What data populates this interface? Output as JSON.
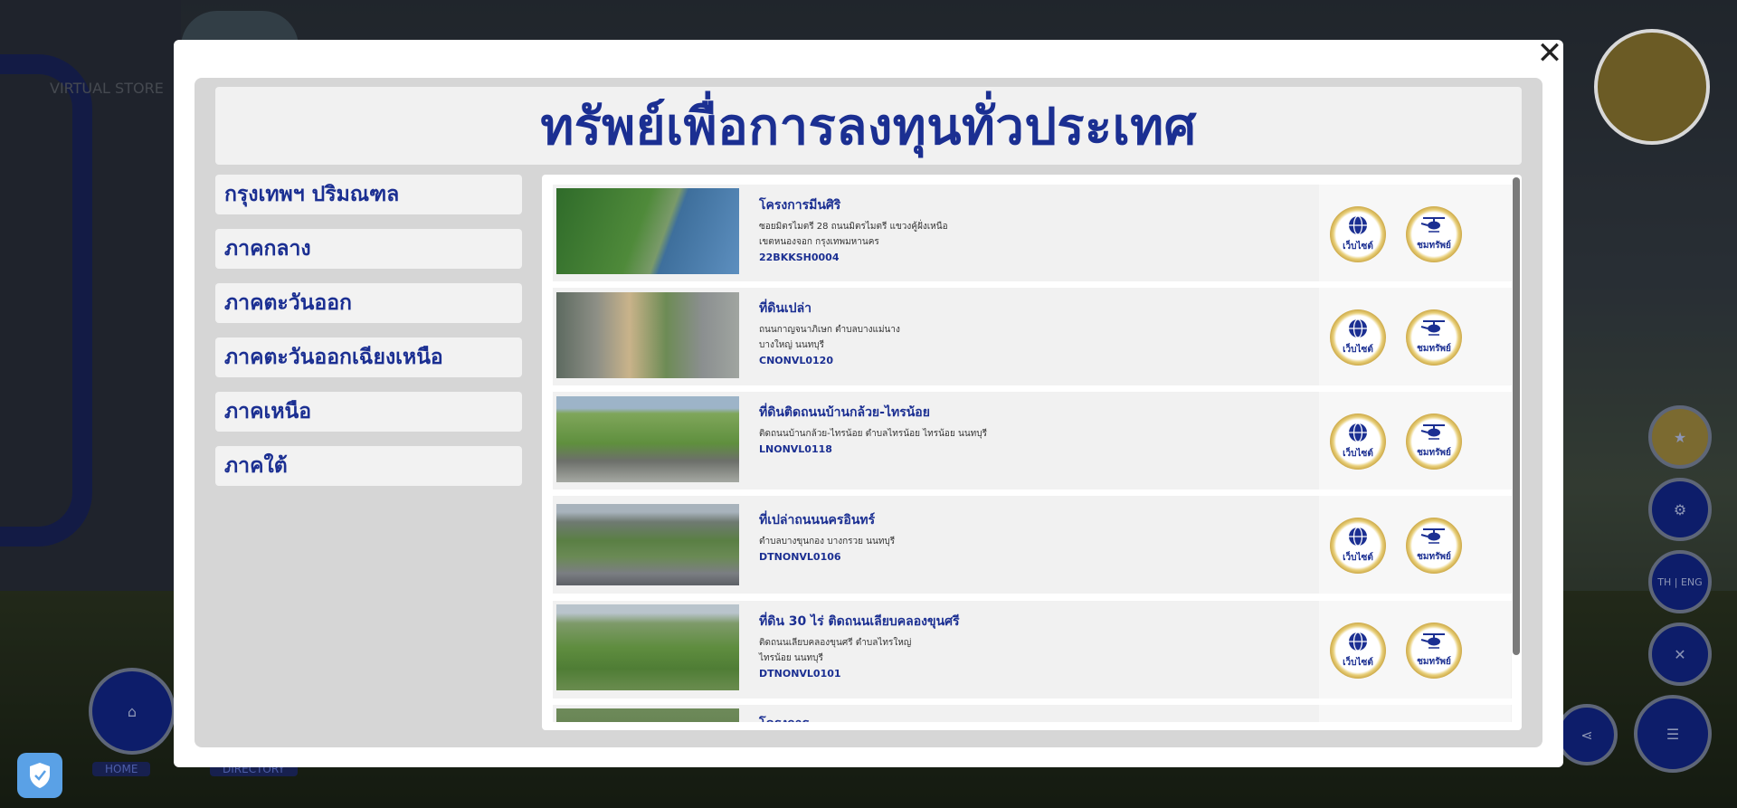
{
  "background": {
    "store_text": "VIRTUAL STORE",
    "home_label": "HOME",
    "directory_label": "DIRECTORY",
    "lang_label": "TH | ENG"
  },
  "modal": {
    "title": "ทรัพย์เพื่อการลงทุนทั่วประเทศ",
    "close_glyph": "✕"
  },
  "regions": [
    {
      "label": "กรุงเทพฯ ปริมณฑล"
    },
    {
      "label": "ภาคกลาง"
    },
    {
      "label": "ภาคตะวันออก"
    },
    {
      "label": "ภาคตะวันออกเฉียงเหนือ"
    },
    {
      "label": "ภาคเหนือ"
    },
    {
      "label": "ภาคใต้"
    }
  ],
  "buttons": {
    "website_label": "เว็บไซต์",
    "view_label": "ชมทรัพย์"
  },
  "properties": [
    {
      "title": "โครงการมีนศิริ",
      "line1": "ซอยมิตรไมตรี 28 ถนนมิตรไมตรี แขวงคู้ฝั่งเหนือ",
      "line2": "เขตหนองจอก กรุงเทพมหานคร",
      "code": "22BKKSH0004"
    },
    {
      "title": "ที่ดินเปล่า",
      "line1": "ถนนกาญจนาภิเษก ตำบลบางแม่นาง",
      "line2": "บางใหญ่ นนทบุรี",
      "code": "CNONVL0120"
    },
    {
      "title": "ที่ดินติดถนนบ้านกล้วย-ไทรน้อย",
      "line1": "ติดถนนบ้านกล้วย-ไทรน้อย ตำบลไทรน้อย ไทรน้อย นนทบุรี",
      "line2": "",
      "code": "LNONVL0118"
    },
    {
      "title": "ที่เปล่าถนนนครอินทร์",
      "line1": "ตำบลบางขุนกอง บางกรวย นนทบุรี",
      "line2": "",
      "code": "DTNONVL0106"
    },
    {
      "title": "ที่ดิน 30 ไร่ ติดถนนเลียบคลองขุนศรี",
      "line1": "ติดถนนเลียบคลองขุนศรี ตำบลไทรใหญ่",
      "line2": "ไทรน้อย นนทบุรี",
      "code": "DTNONVL0101"
    },
    {
      "title": "โครงการ",
      "line1": "",
      "line2": "",
      "code": ""
    }
  ],
  "colors": {
    "brand_blue": "#1b2f92",
    "panel_gray": "#d6d6d6",
    "gold": "#c9a441"
  }
}
